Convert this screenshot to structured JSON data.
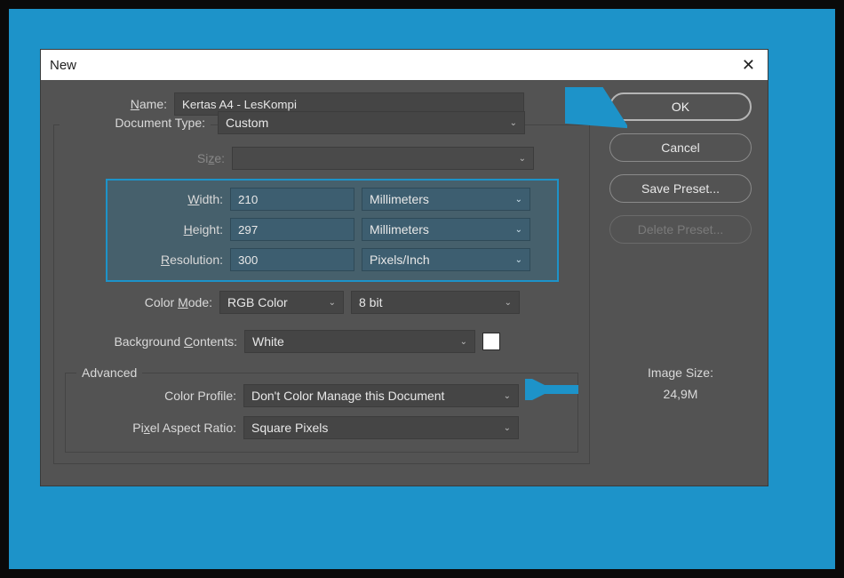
{
  "titlebar": {
    "title": "New"
  },
  "labels": {
    "name": "Name:",
    "docType": "Document Type:",
    "size": "Size:",
    "width": "Width:",
    "height": "Height:",
    "resolution": "Resolution:",
    "colorMode": "Color Mode:",
    "bgContents": "Background Contents:",
    "advanced": "Advanced",
    "colorProfile": "Color Profile:",
    "pixelAspect": "Pixel Aspect Ratio:",
    "imageSize": "Image Size:"
  },
  "values": {
    "name": "Kertas A4 - LesKompi",
    "docType": "Custom",
    "size": "",
    "width": "210",
    "widthUnit": "Millimeters",
    "height": "297",
    "heightUnit": "Millimeters",
    "resolution": "300",
    "resolutionUnit": "Pixels/Inch",
    "colorMode": "RGB Color",
    "bitDepth": "8 bit",
    "bgContents": "White",
    "bgColor": "#ffffff",
    "colorProfile": "Don't Color Manage this Document",
    "pixelAspect": "Square Pixels",
    "imageSizeValue": "24,9M"
  },
  "buttons": {
    "ok": "OK",
    "cancel": "Cancel",
    "savePreset": "Save Preset...",
    "deletePreset": "Delete Preset..."
  }
}
